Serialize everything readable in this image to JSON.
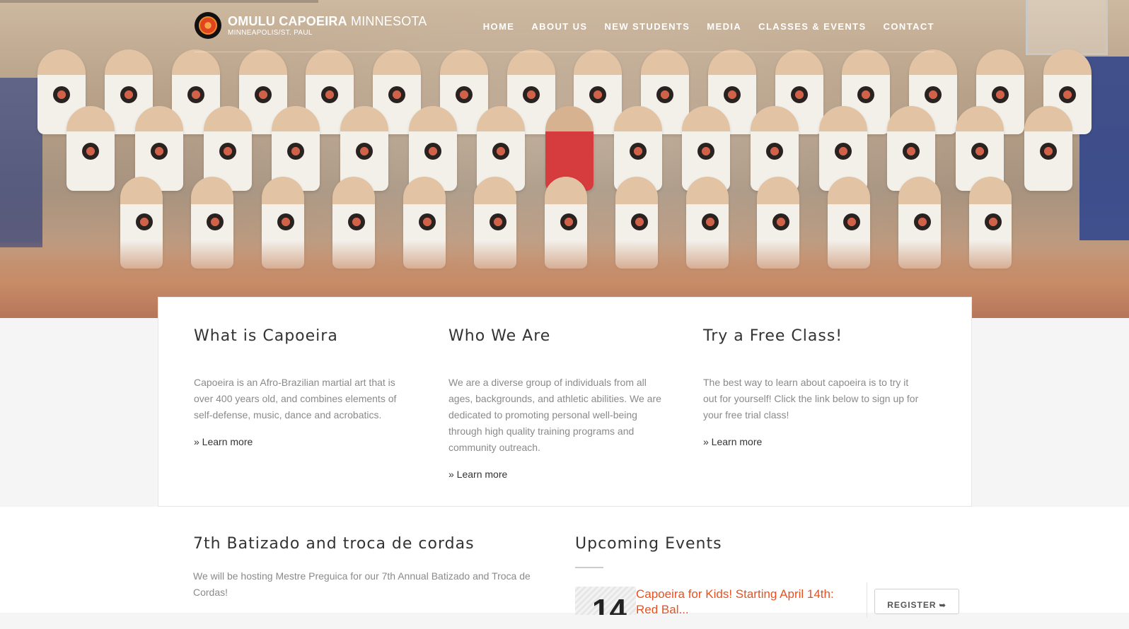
{
  "brand": {
    "title_bold": "OMULU CAPOEIRA",
    "title_light": "MINNESOTA",
    "subtitle": "MINNEAPOLIS/ST. PAUL",
    "logo_icon": "capoeira-logo-icon"
  },
  "nav": {
    "items": [
      "HOME",
      "ABOUT US",
      "NEW STUDENTS",
      "MEDIA",
      "CLASSES & EVENTS",
      "CONTACT"
    ]
  },
  "features": [
    {
      "title": "What is Capoeira",
      "body": "Capoeira is an Afro-Brazilian martial art that is over 400 years old, and combines elements of self-defense, music, dance and acrobatics.",
      "link": "» Learn more"
    },
    {
      "title": "Who We Are",
      "body": "We are a diverse group of individuals from all ages, backgrounds, and athletic abilities. We are dedicated to promoting personal well-being through high quality training programs and community outreach.",
      "link": "» Learn more"
    },
    {
      "title": "Try a Free Class!",
      "body": "The best way to learn about capoeira is to try it out for yourself! Click the link below to sign up for your free trial class!",
      "link": "» Learn more"
    }
  ],
  "news": {
    "title": "7th Batizado and troca de cordas",
    "body": "We will be hosting Mestre Preguica for our 7th Annual Batizado and Troca de Cordas!"
  },
  "events": {
    "title": "Upcoming Events",
    "items": [
      {
        "day": "14",
        "title": "Capoeira for Kids! Starting April 14th: Red Bal...",
        "register_label": "REGISTER",
        "register_icon": "sign-in-icon"
      }
    ]
  },
  "colors": {
    "accent": "#e8501f",
    "heading": "#333333",
    "body_text": "#8a8a8a",
    "page_bg": "#f5f5f5"
  }
}
